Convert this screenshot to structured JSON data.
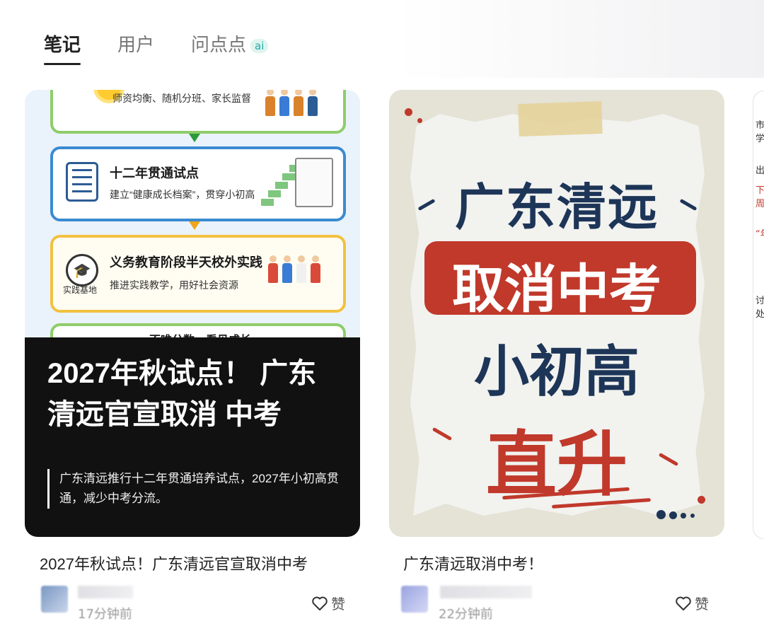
{
  "tabs": [
    {
      "label": "笔记"
    },
    {
      "label": "用户"
    },
    {
      "label": "问点点",
      "badge": "ai"
    }
  ],
  "card1": {
    "infographic": {
      "box1_sub": "师资均衡、随机分班、家长监督",
      "box2_title": "十二年贯通试点",
      "box2_sub": "建立“健康成长档案”，贯穿小初高",
      "box3_title": "义务教育阶段半天校外实践",
      "box3_sub": "推进实践教学，用好社会资源",
      "box3_label": "实践基地",
      "box4_title": "不唯分数，看见成长"
    },
    "overlay_title": "2027年秋试点！ 广东清远官宣取消 中考",
    "overlay_desc": "广东清远推行十二年贯通培养试点，2027年小初高贯通，减少中考分流。",
    "caption": "2027年秋试点！广东清远官宣取消中考",
    "time": "17分钟前",
    "like_label": "赞"
  },
  "card2": {
    "poster_line1": "广东清远",
    "poster_line2": "取消中考",
    "poster_line3": "小初高",
    "poster_line4": "直升",
    "caption": "广东清远取消中考！",
    "time": "22分钟前",
    "like_label": "赞"
  },
  "card3_edge": {
    "t1": "市学",
    "t2": "出，",
    "t3": "下周",
    "t4": "“年",
    "t5": "讨处"
  },
  "colors": {
    "poster_navy": "#1d3557",
    "poster_red": "#c0392b",
    "overlay_bg": "#111111"
  }
}
